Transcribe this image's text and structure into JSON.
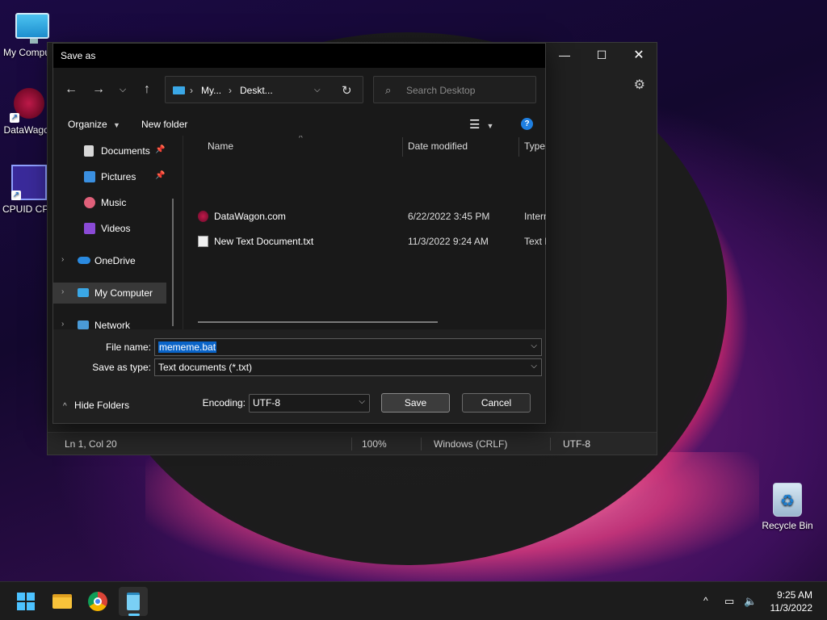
{
  "desktop": {
    "icons": [
      {
        "label": "My Computer"
      },
      {
        "label": "DataWagon"
      },
      {
        "label": "CPUID CPU"
      },
      {
        "label": "Recycle Bin"
      }
    ]
  },
  "notepad": {
    "status": {
      "position": "Ln 1, Col 20",
      "zoom": "100%",
      "line_ending": "Windows (CRLF)",
      "encoding": "UTF-8"
    }
  },
  "dialog": {
    "title": "Save as",
    "address": {
      "crumb1": "My...",
      "crumb2": "Deskt..."
    },
    "search_placeholder": "Search Desktop",
    "toolbar": {
      "organize": "Organize",
      "new_folder": "New folder"
    },
    "nav": [
      {
        "label": "Documents"
      },
      {
        "label": "Pictures"
      },
      {
        "label": "Music"
      },
      {
        "label": "Videos"
      },
      {
        "label": "OneDrive"
      },
      {
        "label": "My Computer"
      },
      {
        "label": "Network"
      }
    ],
    "columns": {
      "name": "Name",
      "date": "Date modified",
      "type": "Type"
    },
    "files": [
      {
        "name": "DataWagon.com",
        "date": "6/22/2022 3:45 PM",
        "type": "Intern"
      },
      {
        "name": "New Text Document.txt",
        "date": "11/3/2022 9:24 AM",
        "type": "Text D"
      }
    ],
    "file_name_label": "File name:",
    "file_name_value": "mememe.bat",
    "save_type_label": "Save as type:",
    "save_type_value": "Text documents (*.txt)",
    "encoding_label": "Encoding:",
    "encoding_value": "UTF-8",
    "save_button": "Save",
    "cancel_button": "Cancel",
    "hide_folders": "Hide Folders"
  },
  "taskbar": {
    "time": "9:25 AM",
    "date": "11/3/2022"
  },
  "colors": {
    "accent": "#0a64c8",
    "taskbar_indicator": "#60cdff"
  }
}
